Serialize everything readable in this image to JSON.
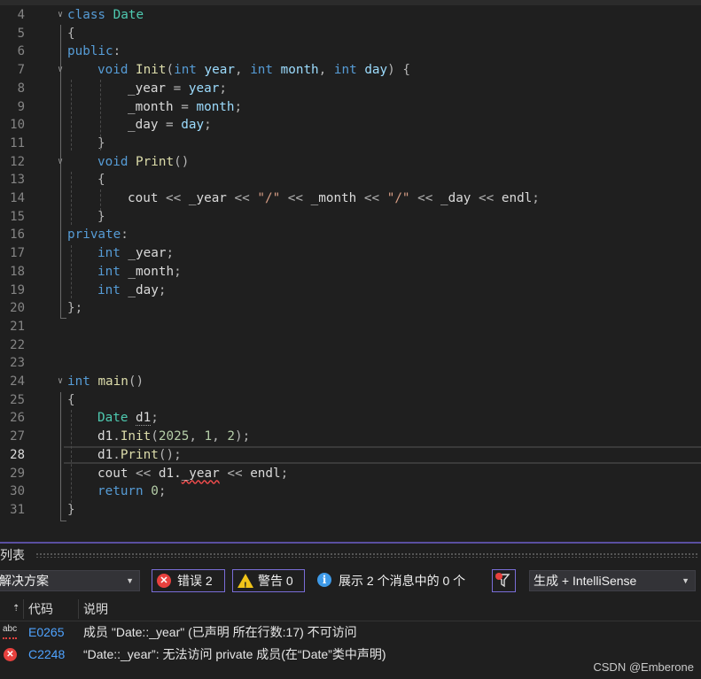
{
  "editor": {
    "lines": [
      {
        "n": "4",
        "indent": 0,
        "current": false,
        "fold": true,
        "tokens": [
          [
            "kw",
            "class"
          ],
          [
            "mv",
            " "
          ],
          [
            "ty",
            "Date"
          ]
        ]
      },
      {
        "n": "5",
        "indent": 0,
        "current": false,
        "fold": false,
        "tokens": [
          [
            "pun",
            "{"
          ]
        ]
      },
      {
        "n": "6",
        "indent": 0,
        "current": false,
        "fold": false,
        "tokens": [
          [
            "kw",
            "public"
          ],
          [
            "pun",
            ":"
          ]
        ]
      },
      {
        "n": "7",
        "indent": 1,
        "current": false,
        "fold": true,
        "tokens": [
          [
            "kw",
            "void"
          ],
          [
            "mv",
            " "
          ],
          [
            "fn",
            "Init"
          ],
          [
            "pun",
            "("
          ],
          [
            "kw",
            "int"
          ],
          [
            "mv",
            " "
          ],
          [
            "par",
            "year"
          ],
          [
            "pun",
            ", "
          ],
          [
            "kw",
            "int"
          ],
          [
            "mv",
            " "
          ],
          [
            "par",
            "month"
          ],
          [
            "pun",
            ", "
          ],
          [
            "kw",
            "int"
          ],
          [
            "mv",
            " "
          ],
          [
            "par",
            "day"
          ],
          [
            "pun",
            ") {"
          ]
        ]
      },
      {
        "n": "8",
        "indent": 2,
        "current": false,
        "fold": false,
        "tokens": [
          [
            "mv",
            "_year"
          ],
          [
            "pun",
            " = "
          ],
          [
            "par",
            "year"
          ],
          [
            "pun",
            ";"
          ]
        ]
      },
      {
        "n": "9",
        "indent": 2,
        "current": false,
        "fold": false,
        "tokens": [
          [
            "mv",
            "_month"
          ],
          [
            "pun",
            " = "
          ],
          [
            "par",
            "month"
          ],
          [
            "pun",
            ";"
          ]
        ]
      },
      {
        "n": "10",
        "indent": 2,
        "current": false,
        "fold": false,
        "tokens": [
          [
            "mv",
            "_day"
          ],
          [
            "pun",
            " = "
          ],
          [
            "par",
            "day"
          ],
          [
            "pun",
            ";"
          ]
        ]
      },
      {
        "n": "11",
        "indent": 1,
        "current": false,
        "fold": false,
        "tokens": [
          [
            "pun",
            "}"
          ]
        ]
      },
      {
        "n": "12",
        "indent": 1,
        "current": false,
        "fold": true,
        "tokens": [
          [
            "kw",
            "void"
          ],
          [
            "mv",
            " "
          ],
          [
            "fn",
            "Print"
          ],
          [
            "pun",
            "()"
          ]
        ]
      },
      {
        "n": "13",
        "indent": 1,
        "current": false,
        "fold": false,
        "tokens": [
          [
            "pun",
            "{"
          ]
        ]
      },
      {
        "n": "14",
        "indent": 2,
        "current": false,
        "fold": false,
        "tokens": [
          [
            "mv",
            "cout"
          ],
          [
            "pun",
            " << "
          ],
          [
            "mv",
            "_year"
          ],
          [
            "pun",
            " << "
          ],
          [
            "str",
            "\"/\""
          ],
          [
            "pun",
            " << "
          ],
          [
            "mv",
            "_month"
          ],
          [
            "pun",
            " << "
          ],
          [
            "str",
            "\"/\""
          ],
          [
            "pun",
            " << "
          ],
          [
            "mv",
            "_day"
          ],
          [
            "pun",
            " << "
          ],
          [
            "mv",
            "endl"
          ],
          [
            "pun",
            ";"
          ]
        ]
      },
      {
        "n": "15",
        "indent": 1,
        "current": false,
        "fold": false,
        "tokens": [
          [
            "pun",
            "}"
          ]
        ]
      },
      {
        "n": "16",
        "indent": 0,
        "current": false,
        "fold": false,
        "tokens": [
          [
            "kw",
            "private"
          ],
          [
            "pun",
            ":"
          ]
        ]
      },
      {
        "n": "17",
        "indent": 1,
        "current": false,
        "fold": false,
        "tokens": [
          [
            "kw",
            "int"
          ],
          [
            "mv",
            " _year"
          ],
          [
            "pun",
            ";"
          ]
        ]
      },
      {
        "n": "18",
        "indent": 1,
        "current": false,
        "fold": false,
        "tokens": [
          [
            "kw",
            "int"
          ],
          [
            "mv",
            " _month"
          ],
          [
            "pun",
            ";"
          ]
        ]
      },
      {
        "n": "19",
        "indent": 1,
        "current": false,
        "fold": false,
        "tokens": [
          [
            "kw",
            "int"
          ],
          [
            "mv",
            " _day"
          ],
          [
            "pun",
            ";"
          ]
        ]
      },
      {
        "n": "20",
        "indent": 0,
        "current": false,
        "fold": false,
        "tokens": [
          [
            "pun",
            "};"
          ]
        ]
      },
      {
        "n": "21",
        "indent": 0,
        "current": false,
        "fold": false,
        "tokens": []
      },
      {
        "n": "22",
        "indent": 0,
        "current": false,
        "fold": false,
        "tokens": []
      },
      {
        "n": "23",
        "indent": 0,
        "current": false,
        "fold": false,
        "tokens": []
      },
      {
        "n": "24",
        "indent": 0,
        "current": false,
        "fold": true,
        "tokens": [
          [
            "kw",
            "int"
          ],
          [
            "mv",
            " "
          ],
          [
            "fn",
            "main"
          ],
          [
            "pun",
            "()"
          ]
        ]
      },
      {
        "n": "25",
        "indent": 0,
        "current": false,
        "fold": false,
        "tokens": [
          [
            "pun",
            "{"
          ]
        ]
      },
      {
        "n": "26",
        "indent": 1,
        "current": false,
        "fold": false,
        "tokens": [
          [
            "ty",
            "Date"
          ],
          [
            "mv",
            " "
          ],
          [
            "dot",
            "d1"
          ],
          [
            "pun",
            ";"
          ]
        ]
      },
      {
        "n": "27",
        "indent": 1,
        "current": false,
        "fold": false,
        "tokens": [
          [
            "mv",
            "d1"
          ],
          [
            "pun",
            "."
          ],
          [
            "fn",
            "Init"
          ],
          [
            "pun",
            "("
          ],
          [
            "num",
            "2025"
          ],
          [
            "pun",
            ", "
          ],
          [
            "num",
            "1"
          ],
          [
            "pun",
            ", "
          ],
          [
            "num",
            "2"
          ],
          [
            "pun",
            ");"
          ]
        ]
      },
      {
        "n": "28",
        "indent": 1,
        "current": true,
        "fold": false,
        "tokens": [
          [
            "mv",
            "d1"
          ],
          [
            "pun",
            "."
          ],
          [
            "fn",
            "Print"
          ],
          [
            "pun",
            "();"
          ]
        ]
      },
      {
        "n": "29",
        "indent": 1,
        "current": false,
        "fold": false,
        "tokens": [
          [
            "mv",
            "cout"
          ],
          [
            "pun",
            " << "
          ],
          [
            "mv",
            "d1."
          ],
          [
            "err",
            "_year"
          ],
          [
            "pun",
            " << "
          ],
          [
            "mv",
            "endl"
          ],
          [
            "pun",
            ";"
          ]
        ]
      },
      {
        "n": "30",
        "indent": 1,
        "current": false,
        "fold": false,
        "tokens": [
          [
            "kw",
            "return"
          ],
          [
            "mv",
            " "
          ],
          [
            "num",
            "0"
          ],
          [
            "pun",
            ";"
          ]
        ]
      },
      {
        "n": "31",
        "indent": 0,
        "current": false,
        "fold": false,
        "tokens": [
          [
            "pun",
            "}"
          ]
        ]
      }
    ]
  },
  "error_list": {
    "title": "列表",
    "scope_combo": "解决方案",
    "errors_label": "错误 2",
    "warnings_label": "警告 0",
    "messages_label": "展示 2 个消息中的 0 个",
    "source_combo": "生成 + IntelliSense",
    "columns": {
      "code": "代码",
      "description": "说明"
    },
    "rows": [
      {
        "icon": "intellisense-abc-icon",
        "code": "E0265",
        "description": "成员 \"Date::_year\" (已声明 所在行数:17) 不可访问"
      },
      {
        "icon": "error-icon",
        "code": "C2248",
        "description": "“Date::_year”: 无法访问 private 成员(在“Date”类中声明)"
      }
    ]
  },
  "watermark": "CSDN @Emberone",
  "colors": {
    "accent": "#7a6dd8",
    "error": "#e8413e",
    "warning": "#f0c419",
    "info": "#3e9ae8",
    "keyword": "#569cd6",
    "type": "#4ec9b0",
    "function": "#dcdcaa"
  }
}
